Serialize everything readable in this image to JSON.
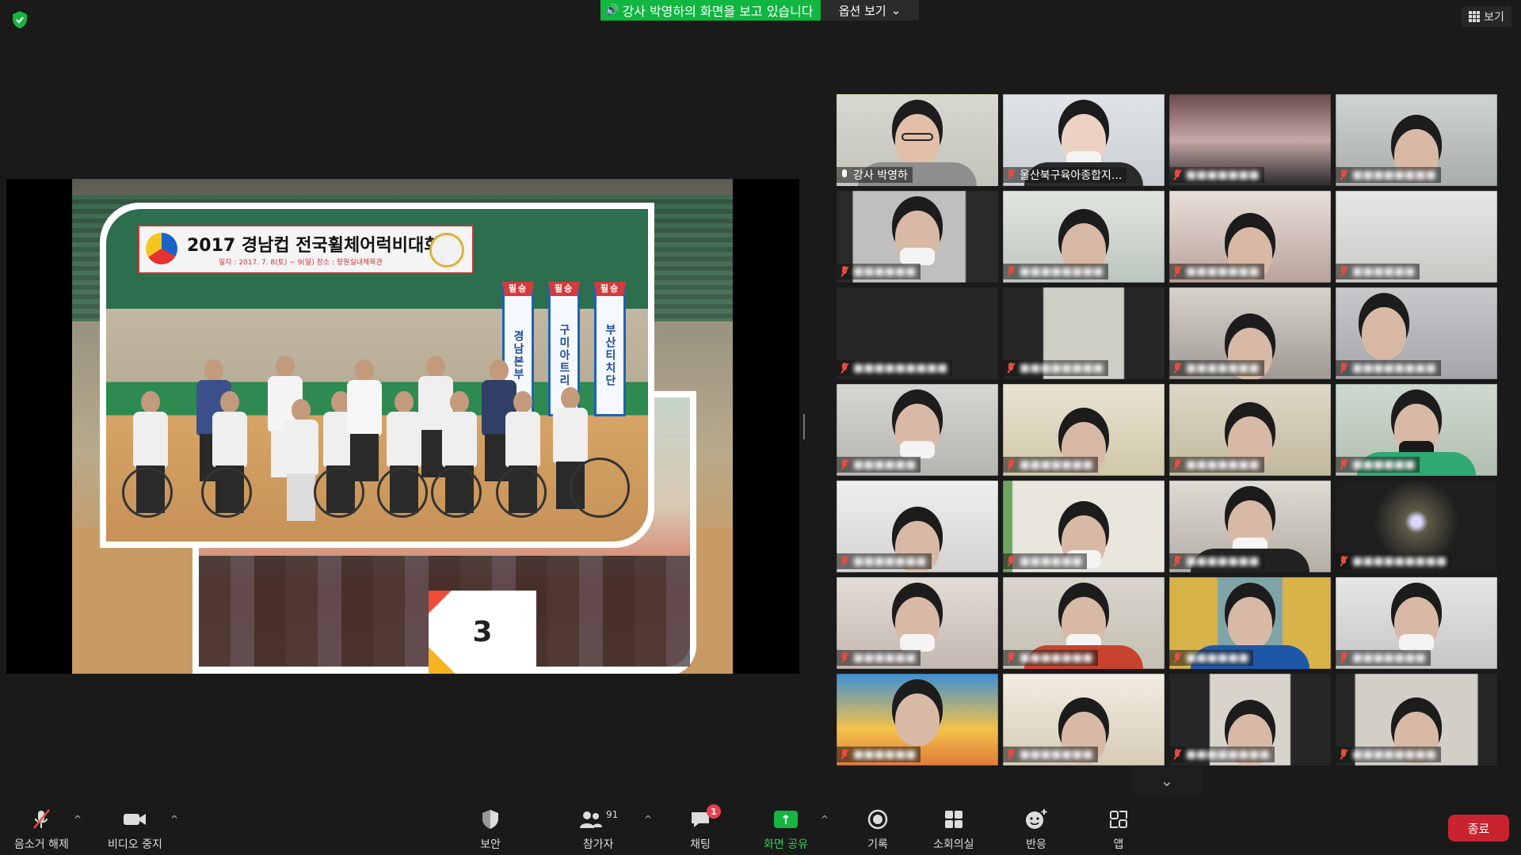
{
  "top": {
    "share_banner": "강사 박영하의 화면을 보고 있습니다",
    "view_options": "옵션 보기",
    "view_button": "보기"
  },
  "slide": {
    "banner_title": "2017 경남컵 전국휠체어럭비대회",
    "banner_sub": "일자 : 2017. 7. 8(토) ~ 9(일)   장소 : 창원실내체육관",
    "pillar_1": "경남본부",
    "pillar_2": "구미아트리",
    "pillar_3": "부산티치단",
    "pillar_label": "필승",
    "number_card": "3"
  },
  "gallery": {
    "tiles": [
      {
        "name": "강사 박영하"
      },
      {
        "name": "울산북구육아종합지..."
      }
    ]
  },
  "toolbar": {
    "mute": "음소거 해제",
    "video": "비디오 중지",
    "security": "보안",
    "participants": "참가자",
    "participants_count": "91",
    "chat": "채팅",
    "chat_badge": "1",
    "share": "화면 공유",
    "record": "기록",
    "breakout": "소회의실",
    "reactions": "반응",
    "apps": "앱",
    "end": "종료"
  },
  "colors": {
    "share_green": "#0fb640",
    "active_speaker": "#b8e04a",
    "end_red": "#c9232f"
  }
}
